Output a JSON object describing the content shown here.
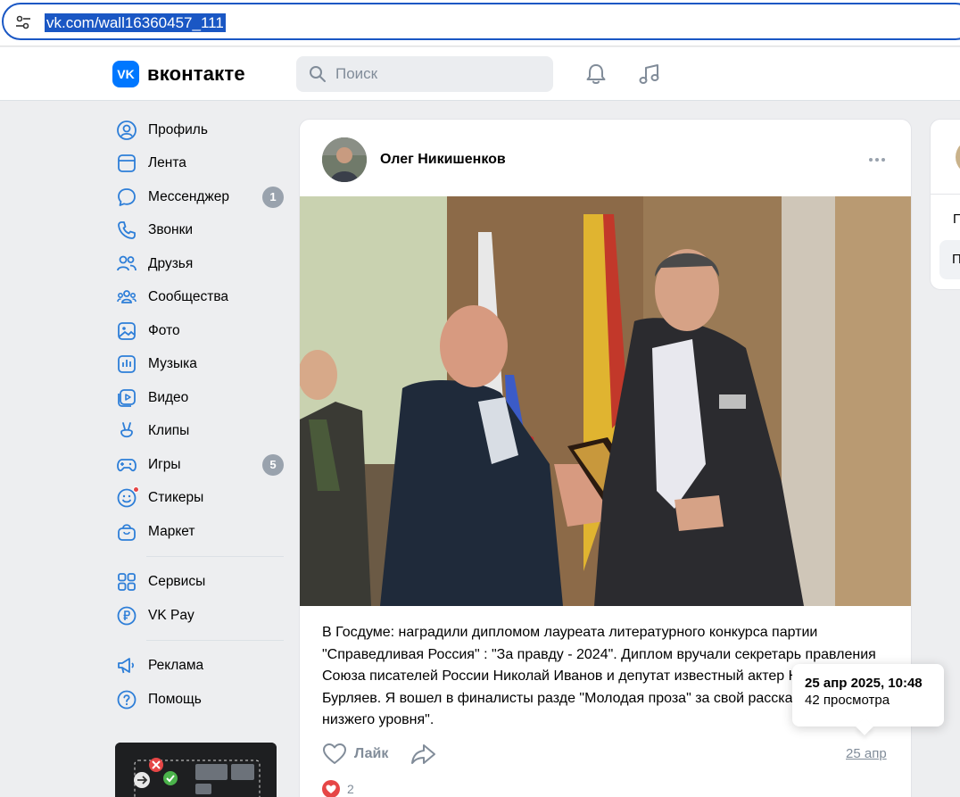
{
  "browser": {
    "url": "vk.com/wall16360457_111",
    "tune_icon": "page-info-icon"
  },
  "header": {
    "logo_text": "VK",
    "wordmark": "вконтакте",
    "search_placeholder": "Поиск",
    "icons": [
      "bell-icon",
      "music-note-icon"
    ]
  },
  "sidebar": {
    "items": [
      {
        "label": "Профиль",
        "icon": "profile-icon"
      },
      {
        "label": "Лента",
        "icon": "feed-icon"
      },
      {
        "label": "Мессенджер",
        "icon": "messenger-icon",
        "badge": "1"
      },
      {
        "label": "Звонки",
        "icon": "phone-icon"
      },
      {
        "label": "Друзья",
        "icon": "friends-icon"
      },
      {
        "label": "Сообщества",
        "icon": "communities-icon"
      },
      {
        "label": "Фото",
        "icon": "photo-icon"
      },
      {
        "label": "Музыка",
        "icon": "music-icon"
      },
      {
        "label": "Видео",
        "icon": "video-icon"
      },
      {
        "label": "Клипы",
        "icon": "clips-icon"
      },
      {
        "label": "Игры",
        "icon": "games-icon",
        "badge": "5"
      },
      {
        "label": "Стикеры",
        "icon": "stickers-icon"
      },
      {
        "label": "Маркет",
        "icon": "market-icon"
      }
    ],
    "items2": [
      {
        "label": "Сервисы",
        "icon": "services-icon"
      },
      {
        "label": "VK Pay",
        "icon": "vkpay-icon"
      }
    ],
    "items3": [
      {
        "label": "Реклама",
        "icon": "ads-icon"
      },
      {
        "label": "Помощь",
        "icon": "help-icon"
      }
    ]
  },
  "post": {
    "author": "Олег Никишенков",
    "text": "В Госдуме: наградили дипломом лауреата литературного конкурса партии \"Справедливая Россия\" : \"За правду - 2024\". Диплом вручали секретарь правления Союза писателей России Николай Иванов и депутат известный актер Николай Бурляев. Я вошел в финалисты разде \"Молодая проза\" за свой рассказ \"Жизнь низжего уровня\".",
    "like_label": "Лайк",
    "date": "25 апр",
    "likes_count": "2"
  },
  "tooltip": {
    "datetime": "25 апр 2025, 10:48",
    "views": "42 просмотра"
  },
  "right_card": {
    "line1": "П",
    "button": "П"
  },
  "colors": {
    "accent": "#0077ff",
    "background": "#edeef0",
    "url_highlight": "#1a57c4",
    "like_red": "#e64646",
    "muted": "#818c99"
  }
}
